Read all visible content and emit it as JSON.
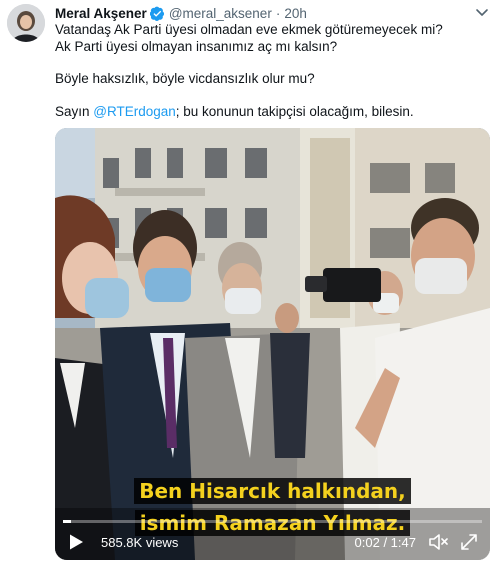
{
  "tweet": {
    "name": "Meral Akşener",
    "handle": "@meral_aksener",
    "separator": "·",
    "time": "20h",
    "line1": "Vatandaş Ak Parti üyesi olmadan eve ekmek götüremeyecek mi?",
    "line2": "Ak Parti üyesi olmayan insanımız aç mı kalsın?",
    "line3": "Böyle haksızlık, böyle vicdansızlık olur mu?",
    "line4_prefix": "Sayın ",
    "mention": "@RTErdogan",
    "line4_suffix": "; bu konunun takipçisi olacağım, bilesin."
  },
  "video": {
    "subtitle_line1": "Ben Hisarcık halkından,",
    "subtitle_line2": "ismim Ramazan Yılmaz.",
    "views": "585.8K views",
    "time_display": "0:02 / 1:47",
    "progress_fraction": 0.02
  },
  "colors": {
    "accent": "#1d9bf0",
    "subtitle_text": "#f4d11e",
    "secondary_text": "#536471"
  },
  "icons": {
    "verified": "verified-badge-icon",
    "more": "chevron-down-icon",
    "play": "play-icon",
    "volume": "volume-muted-icon",
    "fullscreen": "fullscreen-icon"
  }
}
